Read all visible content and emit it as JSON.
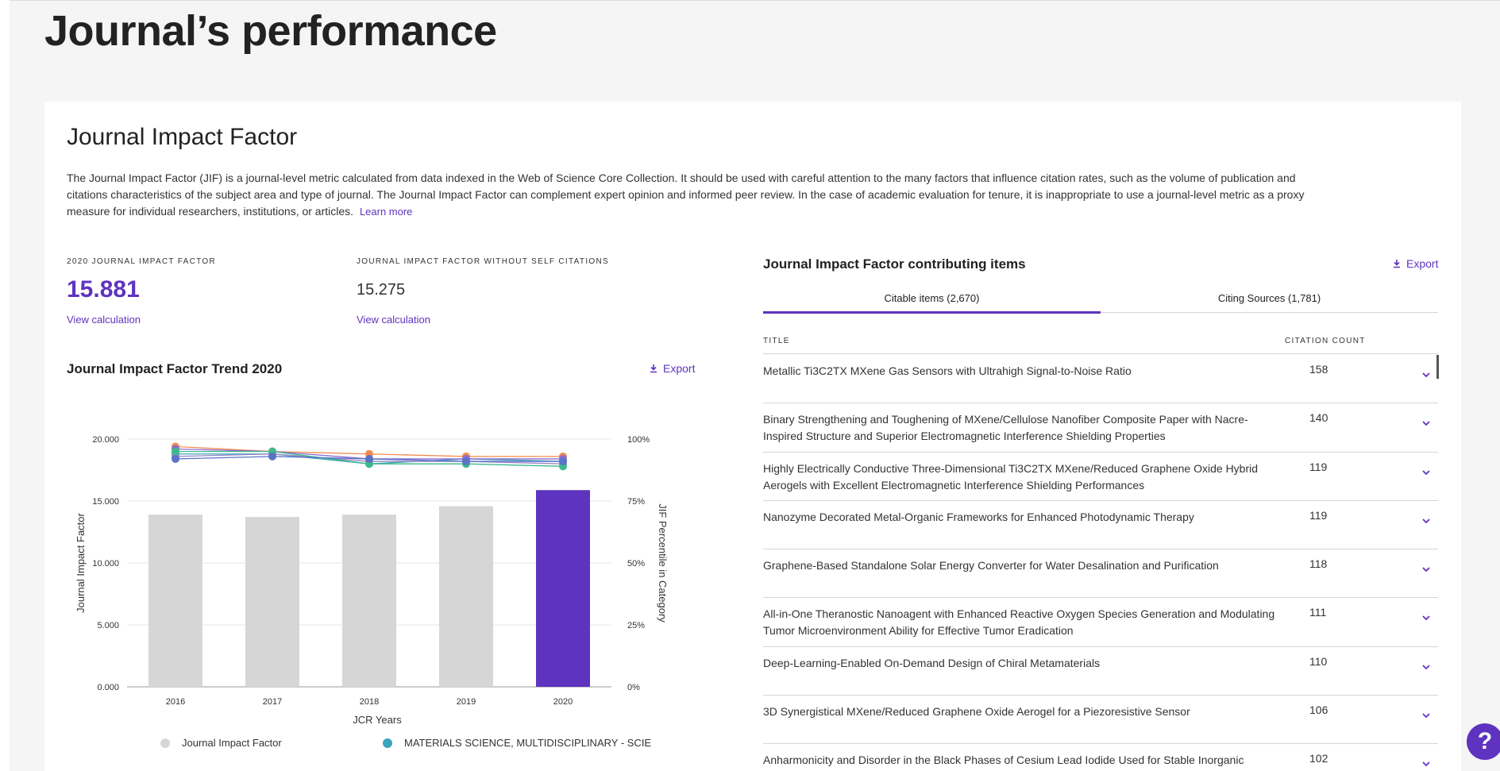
{
  "page": {
    "title": "Journal’s performance"
  },
  "jif": {
    "section_title": "Journal Impact Factor",
    "description": "The Journal Impact Factor (JIF) is a journal-level metric calculated from data indexed in the Web of Science Core Collection. It should be used with careful attention to the many factors that influence citation rates, such as the volume of publication and citations characteristics of the subject area and type of journal. The Journal Impact Factor can complement expert opinion and informed peer review. In the case of academic evaluation for tenure, it is inappropriate to use a journal-level metric as a proxy measure for individual researchers, institutions, or articles.",
    "learn_more": "Learn more",
    "metric1_label": "2020 Journal Impact Factor",
    "metric1_value": "15.881",
    "metric1_link": "View calculation",
    "metric2_label": "Journal Impact Factor without self citations",
    "metric2_value": "15.275",
    "metric2_link": "View calculation"
  },
  "trend": {
    "title": "Journal Impact Factor Trend 2020",
    "export_label": "Export"
  },
  "chart_data": {
    "type": "bar",
    "categories": [
      "2016",
      "2017",
      "2018",
      "2019",
      "2020"
    ],
    "series": [
      {
        "name": "Journal Impact Factor",
        "axis": "left",
        "values": [
          13.903,
          13.709,
          13.903,
          14.588,
          15.881
        ],
        "colors": [
          "#d6d6d6",
          "#d6d6d6",
          "#d6d6d6",
          "#d6d6d6",
          "#5e33bf"
        ]
      }
    ],
    "percentile_series": [
      {
        "name": "MATERIALS SCIENCE, MULTIDISCIPLINARY - SCIE",
        "color": "#3aa6b9",
        "values": [
          94,
          94,
          90,
          92,
          91
        ]
      },
      {
        "color": "#f28c4f",
        "values": [
          97,
          95,
          94,
          93,
          93
        ]
      },
      {
        "color": "#8a6bd1",
        "values": [
          96,
          95,
          92,
          92,
          92
        ]
      },
      {
        "color": "#9a86c6",
        "values": [
          93,
          94,
          91,
          91,
          90
        ]
      },
      {
        "color": "#3fb98a",
        "values": [
          95,
          95,
          90,
          90,
          89
        ]
      },
      {
        "color": "#5a72c8",
        "values": [
          92,
          93,
          92,
          91,
          91
        ]
      }
    ],
    "xlabel": "JCR Years",
    "ylabel": "Journal Impact Factor",
    "ylabel_right": "JIF Percentile in Category",
    "ylim": [
      0,
      20
    ],
    "yticks": [
      "0.000",
      "5.000",
      "10.000",
      "15.000",
      "20.000"
    ],
    "yticks_right": [
      "0%",
      "25%",
      "50%",
      "75%",
      "100%"
    ],
    "legend": [
      {
        "label": "Journal Impact Factor",
        "color": "#d6d6d6"
      },
      {
        "label": "MATERIALS SCIENCE, MULTIDISCIPLINARY - SCIE",
        "color": "#3aa6b9"
      }
    ]
  },
  "contrib": {
    "title": "Journal Impact Factor contributing items",
    "export_label": "Export",
    "tab_citable": "Citable items (2,670)",
    "tab_citing": "Citing Sources (1,781)",
    "col_title": "Title",
    "col_count": "Citation count",
    "rows": [
      {
        "title": "Metallic Ti3C2TX MXene Gas Sensors with Ultrahigh Signal-to-Noise Ratio",
        "count": "158"
      },
      {
        "title": "Binary Strengthening and Toughening of MXene/Cellulose Nanofiber Composite Paper with Nacre-Inspired Structure and Superior Electromagnetic Interference Shielding Properties",
        "count": "140"
      },
      {
        "title": "Highly Electrically Conductive Three-Dimensional Ti3C2TX MXene/Reduced Graphene Oxide Hybrid Aerogels with Excellent Electromagnetic Interference Shielding Performances",
        "count": "119"
      },
      {
        "title": "Nanozyme Decorated Metal-Organic Frameworks for Enhanced Photodynamic Therapy",
        "count": "119"
      },
      {
        "title": "Graphene-Based Standalone Solar Energy Converter for Water Desalination and Purification",
        "count": "118"
      },
      {
        "title": "All-in-One Theranostic Nanoagent with Enhanced Reactive Oxygen Species Generation and Modulating Tumor Microenvironment Ability for Effective Tumor Eradication",
        "count": "111"
      },
      {
        "title": "Deep-Learning-Enabled On-Demand Design of Chiral Metamaterials",
        "count": "110"
      },
      {
        "title": "3D Synergistical MXene/Reduced Graphene Oxide Aerogel for a Piezoresistive Sensor",
        "count": "106"
      },
      {
        "title": "Anharmonicity and Disorder in the Black Phases of Cesium Lead Iodide Used for Stable Inorganic Perovskite",
        "count": "102"
      }
    ]
  },
  "help": {
    "label": "?"
  }
}
